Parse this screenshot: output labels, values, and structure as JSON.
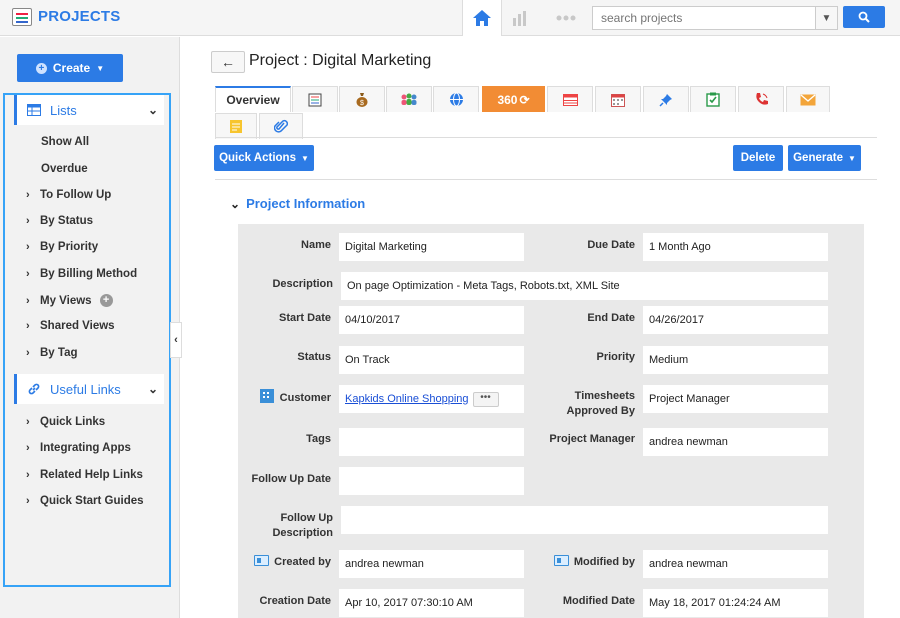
{
  "app": {
    "title": "PROJECTS"
  },
  "search": {
    "placeholder": "search projects"
  },
  "sidebar": {
    "create_label": "Create",
    "lists_header": "Lists",
    "list_items": [
      {
        "label": "Show All"
      },
      {
        "label": "Overdue"
      },
      {
        "label": "To Follow Up"
      },
      {
        "label": "By Status"
      },
      {
        "label": "By Priority"
      },
      {
        "label": "By Billing Method"
      },
      {
        "label": "My Views"
      },
      {
        "label": "Shared Views"
      },
      {
        "label": "By Tag"
      }
    ],
    "useful_header": "Useful Links",
    "useful_items": [
      {
        "label": "Quick Links"
      },
      {
        "label": "Integrating Apps"
      },
      {
        "label": "Related Help Links"
      },
      {
        "label": "Quick Start Guides"
      }
    ]
  },
  "page": {
    "title": "Project : Digital Marketing"
  },
  "tabs": {
    "overview": "Overview",
    "view360": "360",
    "icons": [
      "list-icon",
      "money-bag-icon",
      "people-icon",
      "globe-icon",
      "360-icon",
      "table-icon",
      "calendar-icon",
      "pin-icon",
      "checklist-icon",
      "phone-icon",
      "mail-icon",
      "note-icon",
      "attachment-icon"
    ]
  },
  "toolbar": {
    "quick_actions": "Quick Actions",
    "delete": "Delete",
    "generate": "Generate"
  },
  "section": {
    "title": "Project Information"
  },
  "fields": {
    "name_label": "Name",
    "name_value": "Digital Marketing",
    "due_label": "Due Date",
    "due_value": "1 Month Ago",
    "desc_label": "Description",
    "desc_value": "On page Optimization - Meta Tags, Robots.txt, XML Site",
    "start_label": "Start Date",
    "start_value": "04/10/2017",
    "end_label": "End Date",
    "end_value": "04/26/2017",
    "status_label": "Status",
    "status_value": "On Track",
    "priority_label": "Priority",
    "priority_value": "Medium",
    "customer_label": "Customer",
    "customer_value": "Kapkids Online Shopping",
    "timesheets_label1": "Timesheets",
    "timesheets_label2": "Approved By",
    "timesheets_value": "Project Manager",
    "tags_label": "Tags",
    "tags_value": "",
    "pm_label": "Project Manager",
    "pm_value": "andrea newman",
    "followup_label": "Follow Up Date",
    "followup_value": "",
    "followup_desc_label1": "Follow Up",
    "followup_desc_label2": "Description",
    "followup_desc_value": "",
    "created_by_label": "Created by",
    "created_by_value": "andrea newman",
    "modified_by_label": "Modified by",
    "modified_by_value": "andrea newman",
    "created_date_label": "Creation Date",
    "created_date_value": "Apr 10, 2017 07:30:10 AM",
    "modified_date_label": "Modified Date",
    "modified_date_value": "May 18, 2017 01:24:24 AM"
  },
  "colors": {
    "accent": "#2c7be5",
    "orange_tab": "#f28c34",
    "frame": "#36a3f7"
  }
}
